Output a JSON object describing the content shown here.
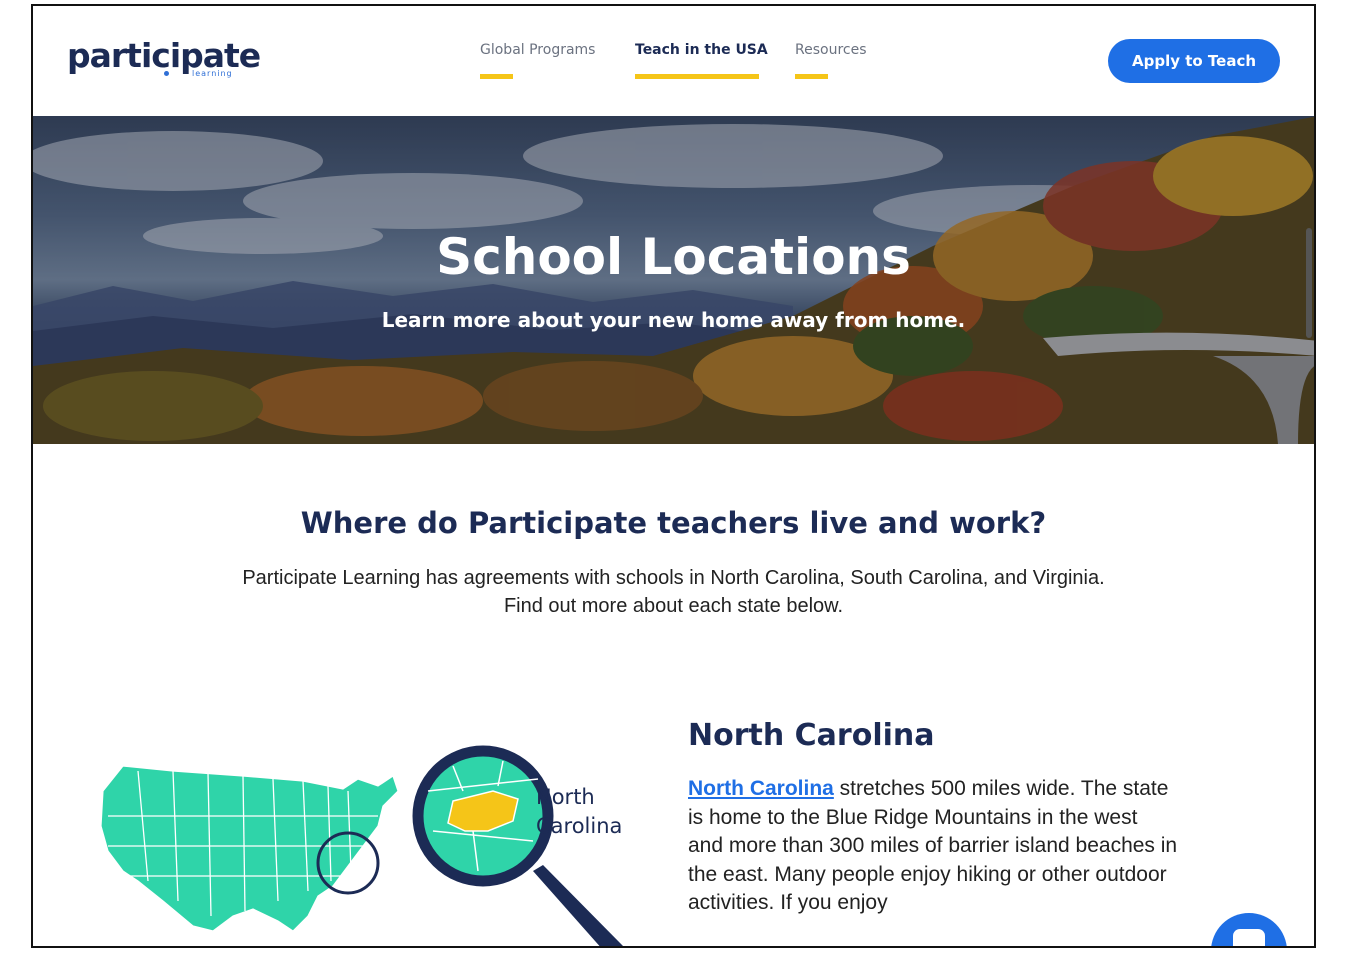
{
  "header": {
    "logo_word": "participate",
    "logo_sub": "learning",
    "nav": [
      {
        "label": "Global Programs",
        "active": false
      },
      {
        "label": "Teach in the USA",
        "active": true
      },
      {
        "label": "Resources",
        "active": false
      }
    ],
    "apply_label": "Apply to Teach"
  },
  "hero": {
    "title": "School Locations",
    "subtitle": "Learn more about your new home away from home."
  },
  "section": {
    "title": "Where do Participate teachers live and work?",
    "intro_line1": "Participate Learning has agreements with schools in North Carolina, South Carolina, and Virginia.",
    "intro_line2": "Find out more about each state below."
  },
  "state": {
    "title": "North Carolina",
    "link_text": "North Carolina",
    "body": " stretches 500 miles wide. The state is home to the Blue Ridge Mountains in the west and more than 300 miles of barrier island beaches in the east. Many people enjoy hiking or other outdoor activities. If you enjoy",
    "map_label_line1": "North",
    "map_label_line2": "Carolina"
  },
  "colors": {
    "brand_navy": "#1c2b55",
    "accent_blue": "#1f6fe5",
    "accent_yellow": "#f5c518",
    "map_green": "#2fd4a9"
  }
}
